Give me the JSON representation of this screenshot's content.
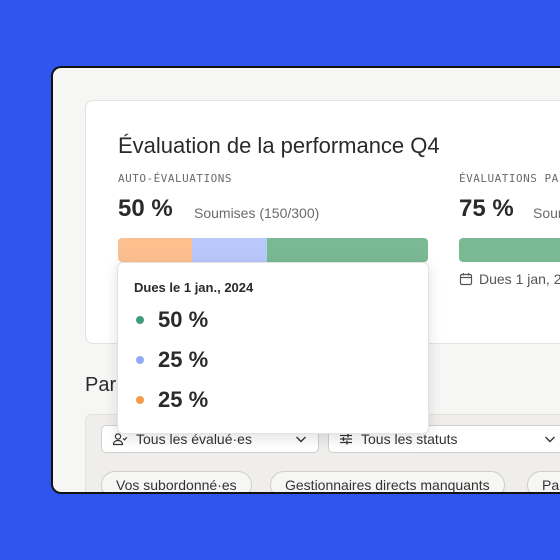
{
  "colors": {
    "background": "#2f55ee",
    "green": "#79b994",
    "blue": "#b9c8fb",
    "orange": "#fdbf8e",
    "dot_green": "#3f9d78",
    "dot_blue": "#93a8f7",
    "dot_orange": "#f39c4a"
  },
  "card": {
    "title": "Évaluation de la performance Q4",
    "self": {
      "eyebrow": "AUTO-ÉVALUATIONS",
      "percent": "50 %",
      "submitted": "Soumises (150/300)",
      "segments": [
        {
          "name": "orange",
          "fraction": 0.24
        },
        {
          "name": "blue",
          "fraction": 0.24
        },
        {
          "name": "green",
          "fraction": 0.52
        }
      ]
    },
    "peer": {
      "eyebrow": "ÉVALUATIONS PA",
      "percent": "75 %",
      "submitted": "Soum",
      "due": "Dues 1 jan, 2",
      "fraction": 1.0
    }
  },
  "tooltip": {
    "title": "Dues le 1 jan., 2024",
    "rows": [
      {
        "value": "50 %",
        "color": "green"
      },
      {
        "value": "25 %",
        "color": "blue"
      },
      {
        "value": "25 %",
        "color": "orange"
      }
    ]
  },
  "section_title": "Par",
  "filters": {
    "evaluees": "Tous les évalué·es",
    "statuts": "Tous les statuts",
    "chips": [
      "Vos subordonné·es",
      "Gestionnaires directs manquants",
      "Pa"
    ]
  }
}
